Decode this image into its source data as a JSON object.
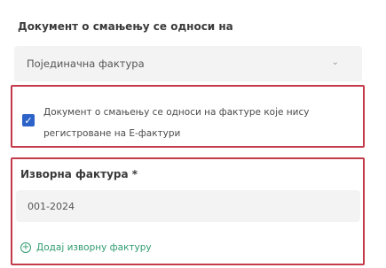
{
  "document_section": {
    "label": "Документ о смањењу се односи на",
    "selected_value": "Појединачна фактура"
  },
  "checkbox_group": {
    "checked": true,
    "label": "Документ о смањењу се односи на фактуре које нису регистроване на Е-фактури"
  },
  "source_invoice": {
    "label": "Изворна фактура *",
    "value": "001-2024",
    "add_label": "Додај изворну фактуру"
  },
  "colors": {
    "highlight_border": "#c33a4a",
    "checkbox": "#2d63c8",
    "link": "#2f9b6e"
  }
}
